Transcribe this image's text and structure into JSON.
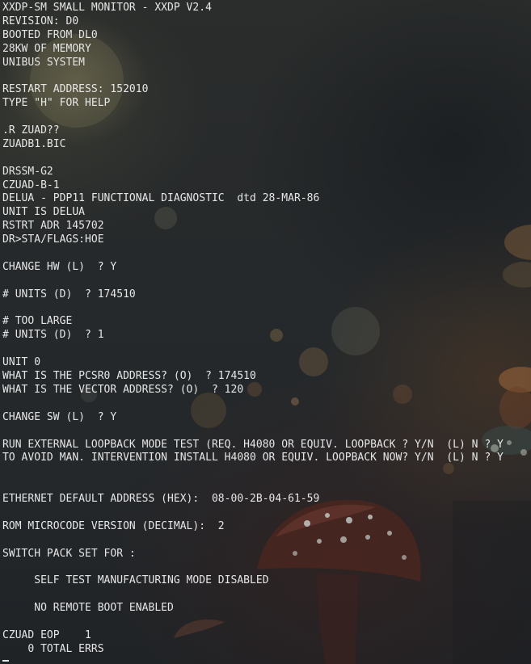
{
  "terminal": {
    "lines": [
      "XXDP-SM SMALL MONITOR - XXDP V2.4",
      "REVISION: D0",
      "BOOTED FROM DL0",
      "28KW OF MEMORY",
      "UNIBUS SYSTEM",
      "",
      "RESTART ADDRESS: 152010",
      "TYPE \"H\" FOR HELP",
      "",
      ".R ZUAD??",
      "ZUADB1.BIC",
      "",
      "DRSSM-G2",
      "CZUAD-B-1",
      "DELUA - PDP11 FUNCTIONAL DIAGNOSTIC  dtd 28-MAR-86",
      "UNIT IS DELUA",
      "RSTRT ADR 145702",
      "DR>STA/FLAGS:HOE",
      "",
      "CHANGE HW (L)  ? Y",
      "",
      "# UNITS (D)  ? 174510",
      "",
      "# TOO LARGE",
      "# UNITS (D)  ? 1",
      "",
      "UNIT 0",
      "WHAT IS THE PCSR0 ADDRESS? (O)  ? 174510",
      "WHAT IS THE VECTOR ADDRESS? (O)  ? 120",
      "",
      "CHANGE SW (L)  ? Y",
      "",
      "RUN EXTERNAL LOOPBACK MODE TEST (REQ. H4080 OR EQUIV. LOOPBACK ? Y/N  (L) N ? Y",
      "TO AVOID MAN. INTERVENTION INSTALL H4080 OR EQUIV. LOOPBACK NOW? Y/N  (L) N ? Y",
      "",
      "",
      "ETHERNET DEFAULT ADDRESS (HEX):  08-00-2B-04-61-59",
      "",
      "ROM MICROCODE VERSION (DECIMAL):  2",
      "",
      "SWITCH PACK SET FOR :",
      "",
      "     SELF TEST MANUFACTURING MODE DISABLED",
      "",
      "     NO REMOTE BOOT ENABLED",
      "",
      "CZUAD EOP    1",
      "    0 TOTAL ERRS"
    ]
  },
  "colors": {
    "text": "#e6e6e6",
    "background": "#262a2c"
  }
}
